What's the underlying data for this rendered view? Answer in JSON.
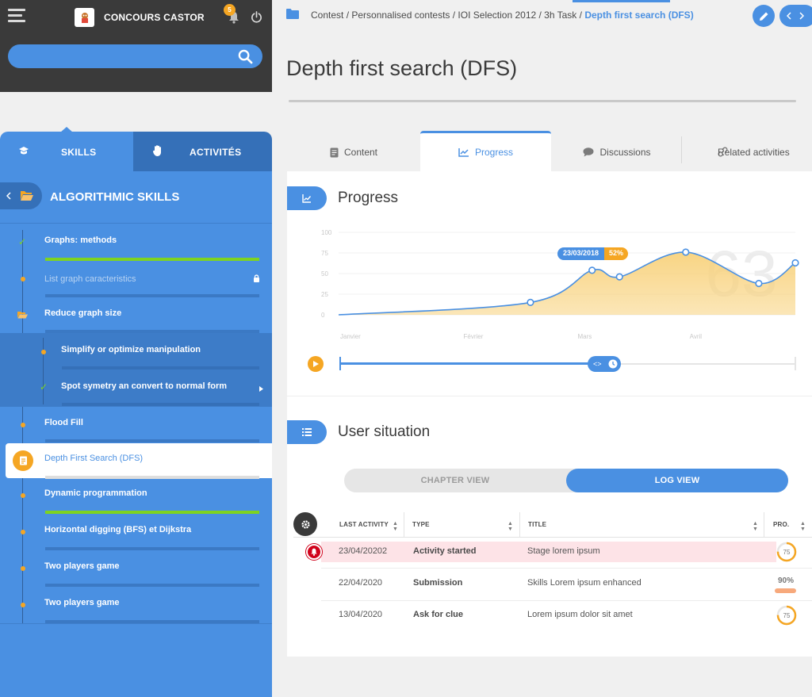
{
  "topbar": {
    "brand": "CONCOURS CASTOR",
    "notif_count": "5"
  },
  "search": {
    "value": "",
    "placeholder": ""
  },
  "left_tabs": {
    "skills": "SKILLS",
    "activities": "ACTIVITÉS"
  },
  "skills_title": "ALGORITHMIC SKILLS",
  "skills": [
    {
      "label": "Graphs: methods",
      "progress": 1.0,
      "status": "done"
    },
    {
      "label": "List graph caracteristics",
      "progress": 0,
      "status": "locked"
    },
    {
      "label": "Reduce graph size",
      "progress": 0,
      "status": "open-folder"
    },
    {
      "label": "Simplify or optimize manipulation",
      "progress": 0,
      "status": "in-progress"
    },
    {
      "label": "Spot symetry an convert to normal form",
      "progress": 0,
      "status": "done"
    },
    {
      "label": "Flood Fill",
      "progress": 0,
      "status": "in-progress"
    },
    {
      "label": "Depth First Search (DFS)",
      "progress": 0,
      "status": "selected"
    },
    {
      "label": "Dynamic programmation",
      "progress": 1.0,
      "status": "in-progress"
    },
    {
      "label": "Horizontal digging (BFS) et Dijkstra",
      "progress": 0,
      "status": "in-progress"
    },
    {
      "label": "Two players game",
      "progress": 0,
      "status": "in-progress"
    },
    {
      "label": "Two players game",
      "progress": 0,
      "status": "in-progress"
    }
  ],
  "breadcrumb": {
    "path": "Contest / Personnalised contests / IOI Selection 2012 / 3h Task /",
    "current": "Depth first search (DFS)"
  },
  "page_title": "Depth first search (DFS)",
  "content_tabs": [
    "Content",
    "Progress",
    "Discussions",
    "Related activities"
  ],
  "progress_section": {
    "title": "Progress",
    "big_number": "63",
    "tooltip_date": "23/03/2018",
    "tooltip_value": "52%"
  },
  "chart_data": {
    "type": "area",
    "title": "",
    "xlabel": "",
    "ylabel": "",
    "ylim": [
      0,
      100
    ],
    "y_ticks": [
      "0",
      "25",
      "50",
      "75",
      "100"
    ],
    "x_ticks": [
      "Janvier",
      "Février",
      "Mars",
      "Avril"
    ],
    "points": [
      {
        "x": 0.0,
        "y": 0
      },
      {
        "x": 0.42,
        "y": 15
      },
      {
        "x": 0.555,
        "y": 54
      },
      {
        "x": 0.615,
        "y": 46
      },
      {
        "x": 0.76,
        "y": 76
      },
      {
        "x": 0.92,
        "y": 38
      },
      {
        "x": 1.0,
        "y": 63
      }
    ],
    "markers": [
      1,
      2,
      3,
      4,
      5,
      6
    ],
    "grid": true,
    "colors": {
      "line": "#4a90e2",
      "fill": "#f8d27d"
    }
  },
  "timeline": {
    "position": 0.56
  },
  "user_situation": {
    "title": "User situation",
    "toggle": {
      "left": "CHAPTER VIEW",
      "right": "LOG VIEW",
      "active": "right"
    }
  },
  "table": {
    "headers": [
      "LAST ACTIVITY",
      "TYPE",
      "TITLE",
      "PRO."
    ],
    "rows": [
      {
        "date": "23/04/20202",
        "type": "Activity started",
        "title": "Stage lorem ipsum",
        "pro": "75",
        "kind": "ring",
        "alert": true
      },
      {
        "date": "22/04/2020",
        "type": "Submission",
        "title": "Skills Lorem ipsum enhanced",
        "pro": "90%",
        "kind": "bar",
        "alert": false
      },
      {
        "date": "13/04/2020",
        "type": "Ask for clue",
        "title": "Lorem ipsum dolor sit amet",
        "pro": "75",
        "kind": "ring",
        "alert": false
      }
    ]
  }
}
